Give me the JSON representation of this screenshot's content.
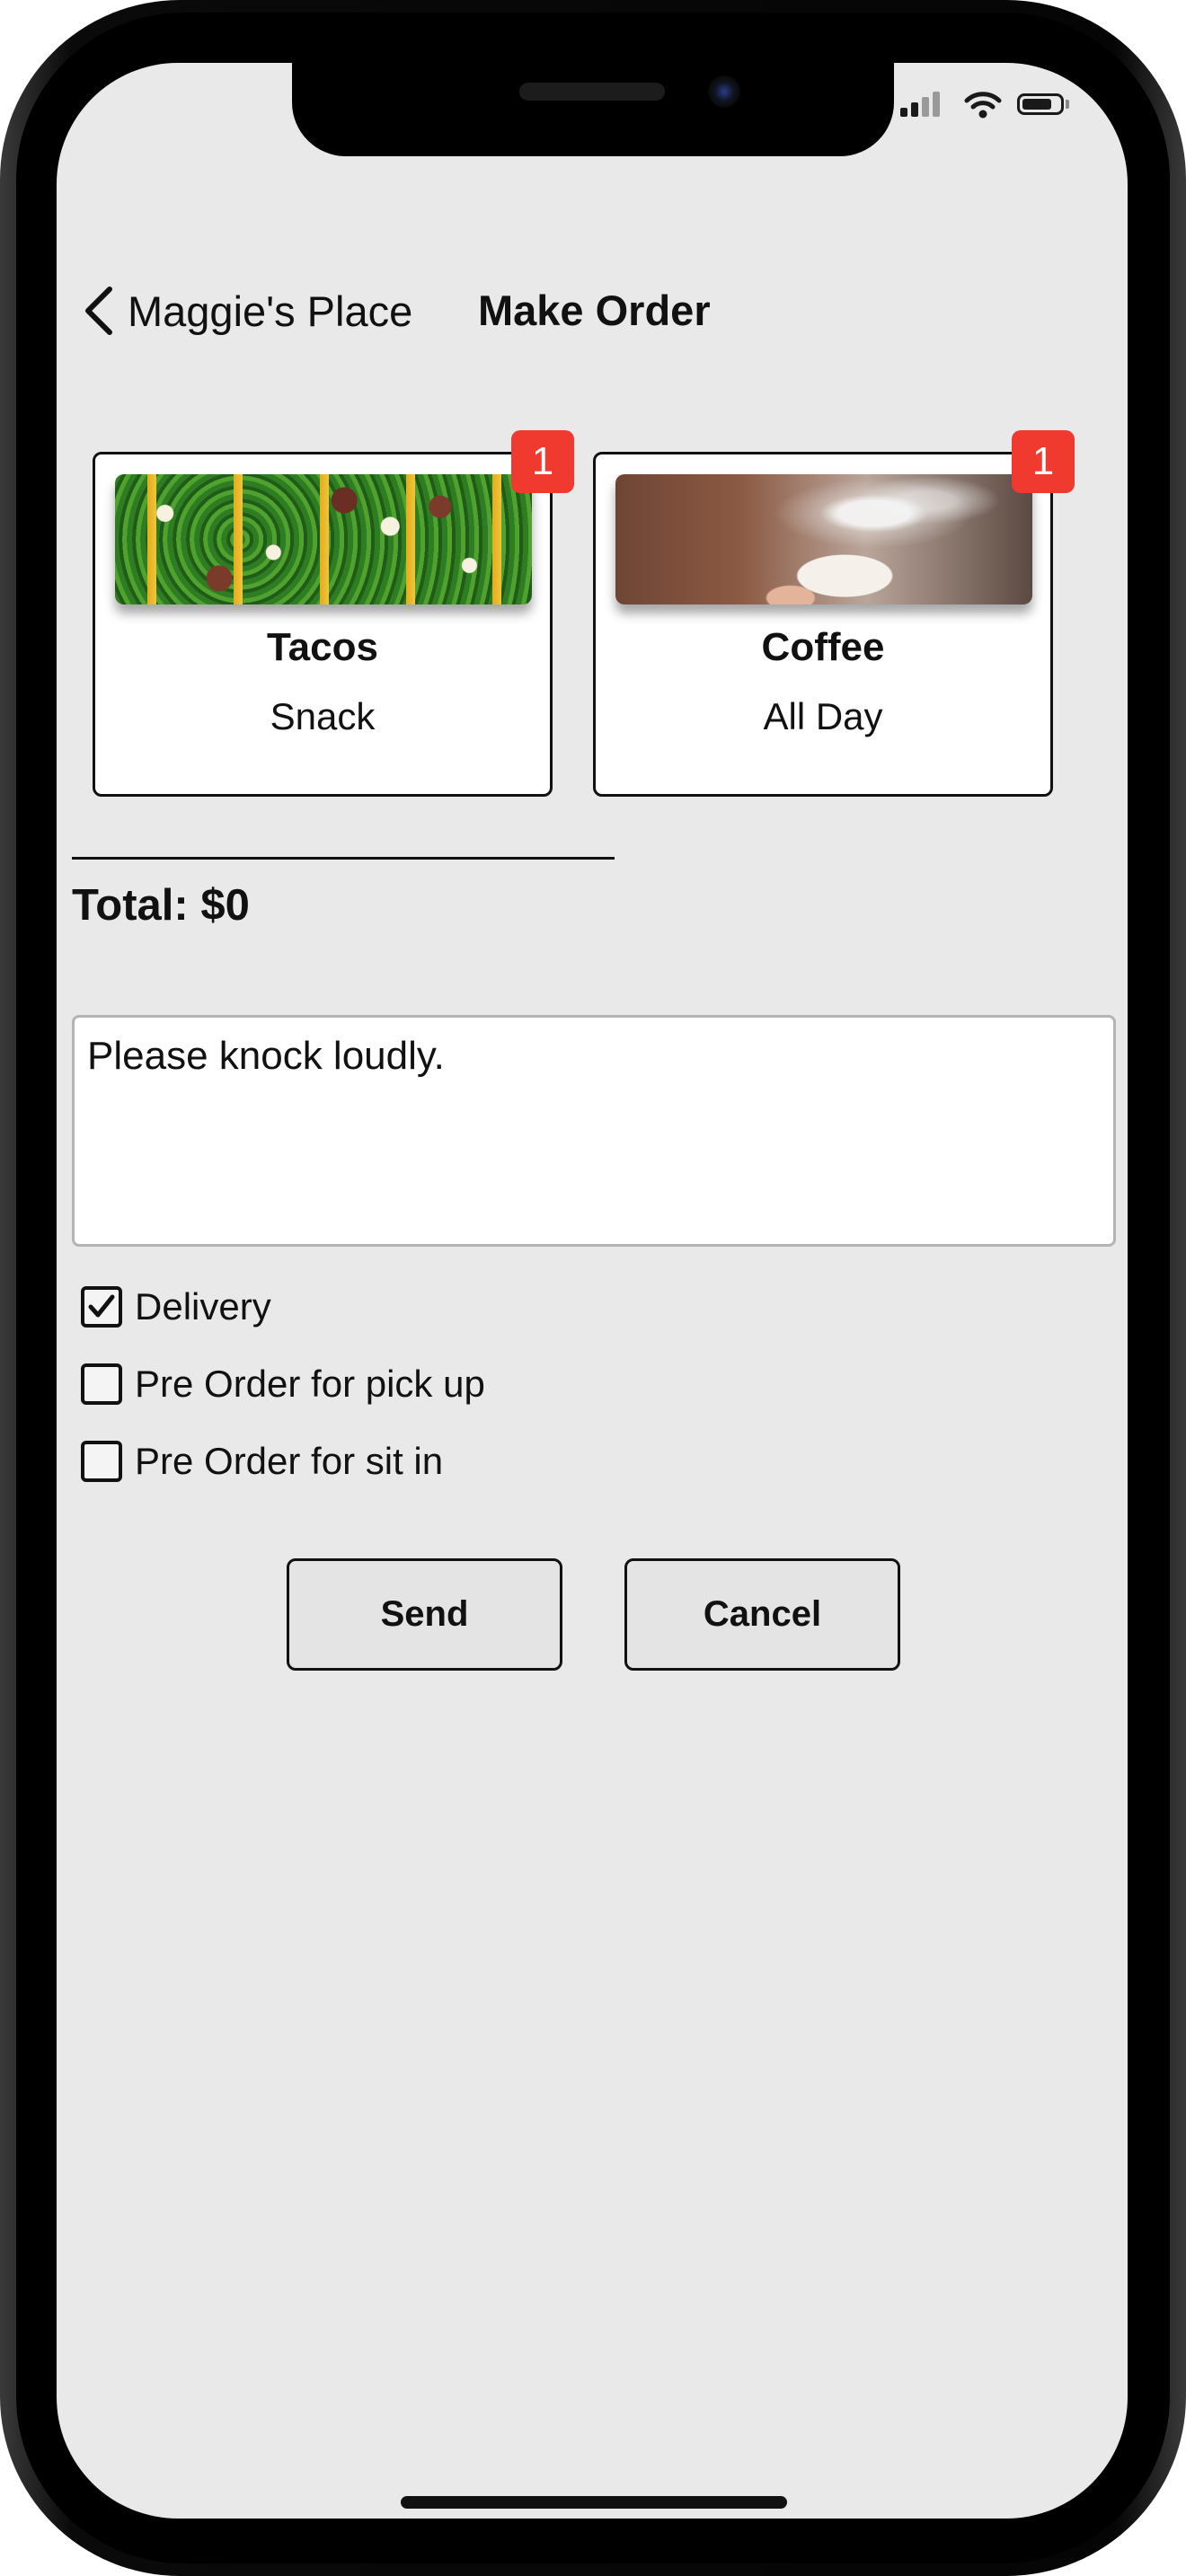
{
  "nav": {
    "back_label": "Maggie's Place",
    "title": "Make Order"
  },
  "items": [
    {
      "name": "Tacos",
      "category": "Snack",
      "count": "1",
      "image": "tacos-photo"
    },
    {
      "name": "Coffee",
      "category": "All Day",
      "count": "1",
      "image": "coffee-photo"
    }
  ],
  "total": "Total: $0",
  "notes": {
    "value": "Please knock loudly."
  },
  "options": [
    {
      "label": "Delivery",
      "checked": true
    },
    {
      "label": "Pre Order for pick up",
      "checked": false
    },
    {
      "label": "Pre Order for sit in",
      "checked": false
    }
  ],
  "buttons": {
    "send": "Send",
    "cancel": "Cancel"
  },
  "colors": {
    "screen_bg": "#e9e9e9",
    "badge": "#f03a2f",
    "button_bg": "#e4e4e4"
  },
  "icons": {
    "back": "chevron-left-icon",
    "signal": "cellular-signal-icon",
    "wifi": "wifi-icon",
    "battery": "battery-icon",
    "check": "checkmark-icon"
  }
}
